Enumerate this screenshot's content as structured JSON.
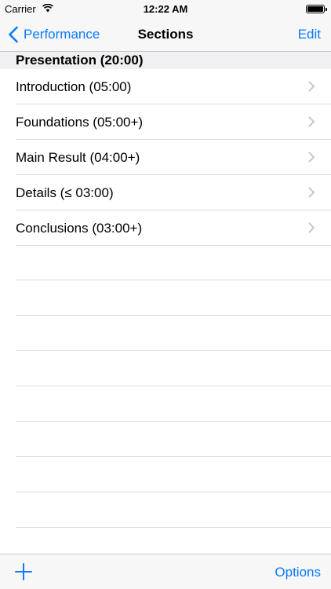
{
  "status_bar": {
    "carrier": "Carrier",
    "time": "12:22 AM"
  },
  "nav": {
    "back_label": "Performance",
    "title": "Sections",
    "edit_label": "Edit"
  },
  "section": {
    "header": "Presentation (20:00)"
  },
  "rows": [
    {
      "label": "Introduction (05:00)"
    },
    {
      "label": "Foundations (05:00+)"
    },
    {
      "label": "Main Result (04:00+)"
    },
    {
      "label": "Details (≤ 03:00)"
    },
    {
      "label": "Conclusions (03:00+)"
    }
  ],
  "toolbar": {
    "options_label": "Options"
  },
  "colors": {
    "accent": "#0a7aff",
    "bar_background": "#f7f7f7",
    "separator": "#dcdcdf",
    "header_background": "#f0f0f2"
  }
}
